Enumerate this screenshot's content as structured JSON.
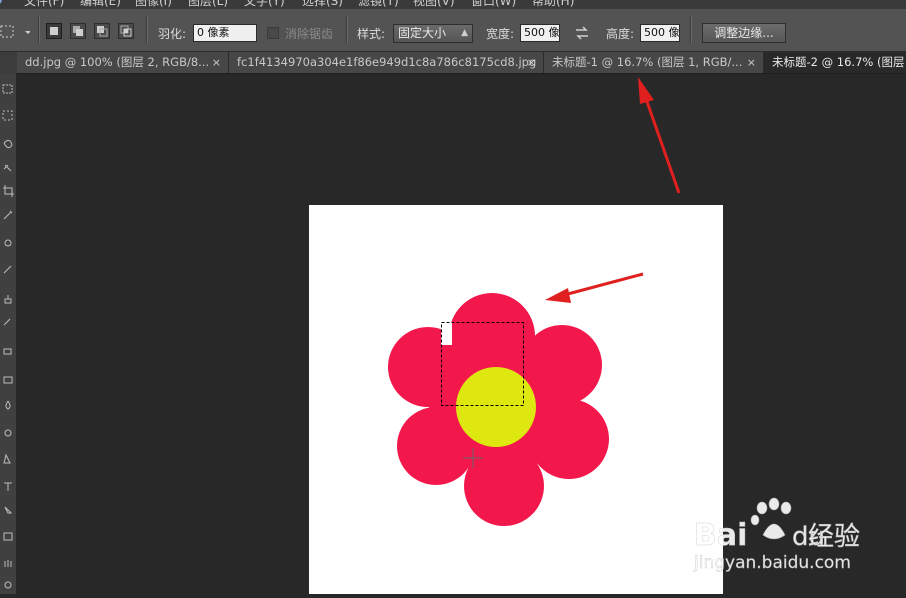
{
  "menubar": {
    "items": [
      "文件(F)",
      "编辑(E)",
      "图像(I)",
      "图层(L)",
      "文字(Y)",
      "选择(S)",
      "滤镜(T)",
      "视图(V)",
      "窗口(W)",
      "帮助(H)"
    ]
  },
  "options_bar": {
    "feather_label": "羽化:",
    "feather_value": "0 像素",
    "antialias_label": "消除锯齿",
    "style_label": "样式:",
    "style_value": "固定大小",
    "width_label": "宽度:",
    "width_value": "500 像",
    "swap_icon": "swap-icon",
    "height_label": "高度:",
    "height_value": "500 像",
    "refine_edge_button": "调整边缘..."
  },
  "tabs": [
    {
      "title": "dd.jpg @ 100% (图层 2, RGB/8...",
      "close": "×",
      "active": false
    },
    {
      "title": "fc1f4134970a304e1f86e949d1c8a786c8175cd8.jpg",
      "close": "×",
      "active": false
    },
    {
      "title": "未标题-1 @ 16.7% (图层 1, RGB/...",
      "close": "×",
      "active": false
    },
    {
      "title": "未标题-2 @ 16.7% (图层",
      "close": "",
      "active": true
    }
  ],
  "canvas": {
    "background": "#ffffff",
    "petal_color": "#f3184c",
    "center_color": "#dfe711"
  },
  "annotations": {
    "arrow_color": "#e0201f"
  },
  "watermark": {
    "brand": "Bai",
    "brand_suffix": "du",
    "product": "经验",
    "url": "jingyan.baidu.com"
  },
  "colors": {
    "workspace": "#282828",
    "options_bar": "#535353",
    "tab_bar": "#3c3c3c",
    "active_tab": "#292929"
  }
}
